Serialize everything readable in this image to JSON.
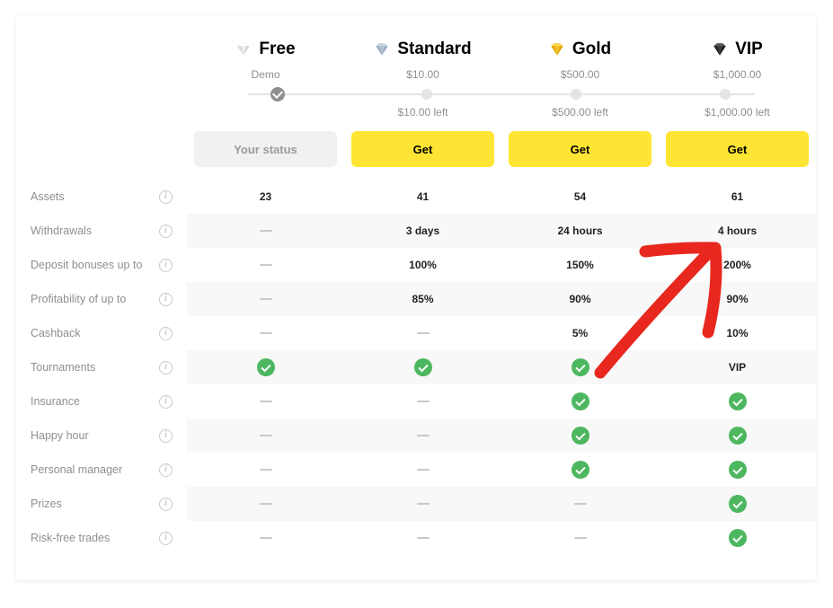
{
  "tiers": [
    {
      "key": "free",
      "name": "Free",
      "threshold": "Demo",
      "left": "",
      "action": "Your status",
      "diamondColors": [
        "#d4d4d4",
        "#ffffff"
      ]
    },
    {
      "key": "standard",
      "name": "Standard",
      "threshold": "$10.00",
      "left": "$10.00 left",
      "action": "Get",
      "diamondColors": [
        "#9aadc2",
        "#c9d5e2"
      ]
    },
    {
      "key": "gold",
      "name": "Gold",
      "threshold": "$500.00",
      "left": "$500.00 left",
      "action": "Get",
      "diamondColors": [
        "#e3a500",
        "#ffd84d"
      ]
    },
    {
      "key": "vip",
      "name": "VIP",
      "threshold": "$1,000.00",
      "left": "$1,000.00 left",
      "action": "Get",
      "diamondColors": [
        "#1c1c1c",
        "#5a5a5a"
      ]
    }
  ],
  "features": [
    {
      "label": "Assets",
      "values": [
        "23",
        "41",
        "54",
        "61"
      ],
      "alt": false
    },
    {
      "label": "Withdrawals",
      "values": [
        "dash",
        "3 days",
        "24 hours",
        "4 hours"
      ],
      "alt": true
    },
    {
      "label": "Deposit bonuses up to",
      "values": [
        "dash",
        "100%",
        "150%",
        "200%"
      ],
      "alt": false
    },
    {
      "label": "Profitability of up to",
      "values": [
        "dash",
        "85%",
        "90%",
        "90%"
      ],
      "alt": true
    },
    {
      "label": "Cashback",
      "values": [
        "dash",
        "dash",
        "5%",
        "10%"
      ],
      "alt": false
    },
    {
      "label": "Tournaments",
      "values": [
        "check",
        "check",
        "check",
        "VIP"
      ],
      "alt": true
    },
    {
      "label": "Insurance",
      "values": [
        "dash",
        "dash",
        "check",
        "check"
      ],
      "alt": false
    },
    {
      "label": "Happy hour",
      "values": [
        "dash",
        "dash",
        "check",
        "check"
      ],
      "alt": true
    },
    {
      "label": "Personal manager",
      "values": [
        "dash",
        "dash",
        "check",
        "check"
      ],
      "alt": false
    },
    {
      "label": "Prizes",
      "values": [
        "dash",
        "dash",
        "dash",
        "check"
      ],
      "alt": true
    },
    {
      "label": "Risk-free trades",
      "values": [
        "dash",
        "dash",
        "dash",
        "check"
      ],
      "alt": false
    }
  ],
  "annotation_color": "#e8281e"
}
